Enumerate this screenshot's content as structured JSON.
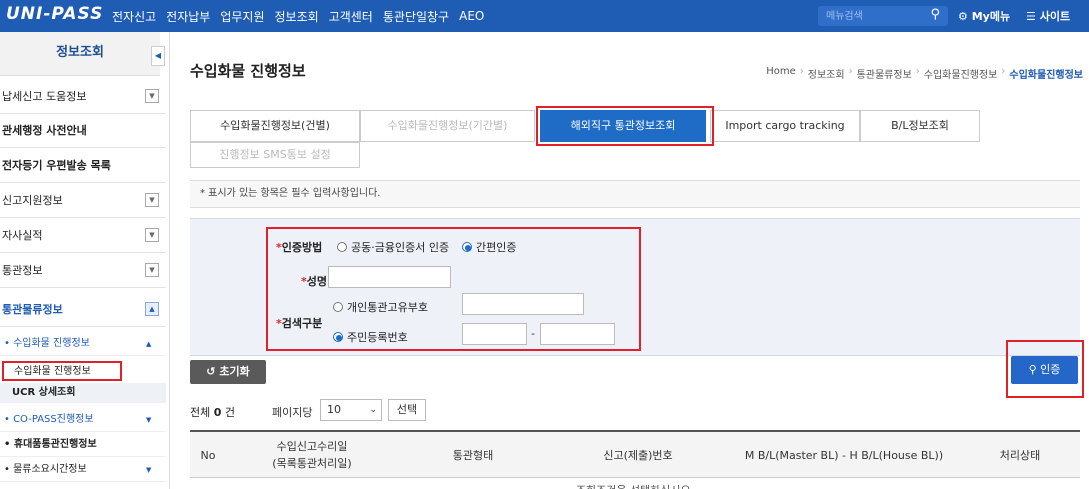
{
  "topbar": {
    "logo": "UNI-PASS",
    "nav": [
      "전자신고",
      "전자납부",
      "업무지원",
      "정보조회",
      "고객센터",
      "통관단일창구",
      "AEO"
    ],
    "search_placeholder": "메뉴검색",
    "mymenu": "My메뉴",
    "site": "사이트",
    "colors": {
      "bar": "#1f5cb4"
    }
  },
  "sidebar": {
    "title": "정보조회",
    "items": [
      {
        "label": "납세신고 도움정보",
        "chevron": "down",
        "bold": false
      },
      {
        "label": "관세행정 사전안내",
        "chevron": "",
        "bold": true
      },
      {
        "label": "전자등기 우편발송 목록",
        "chevron": "",
        "bold": true
      },
      {
        "label": "신고지원정보",
        "chevron": "down",
        "bold": false
      },
      {
        "label": "자사실적",
        "chevron": "down",
        "bold": false
      },
      {
        "label": "통관정보",
        "chevron": "down",
        "bold": false
      },
      {
        "label": "통관물류정보",
        "chevron": "up",
        "bold": false,
        "active": true
      }
    ],
    "sub": {
      "cargo": "수입화물 진행정보",
      "cargo_leaf": "수입화물 진행정보",
      "ucr": "UCR 상세조회",
      "copass": "CO-PASS진행정보",
      "handcarry": "휴대품통관진행정보",
      "logistics": "물류소요시간정보"
    }
  },
  "main": {
    "title": "수입화물 진행정보",
    "breadcrumb": [
      "Home",
      "정보조회",
      "통관물류정보",
      "수입화물진행정보",
      "수입화물진행정보"
    ],
    "tabs": [
      "수입화물진행정보(건별)",
      "수입화물진행정보(기간별)",
      "해외직구 통관정보조회",
      "Import cargo tracking",
      "B/L정보조회",
      "진행정보 SMS통보 설정"
    ],
    "notice": "* 표시가 있는 항목은 필수 입력사항입니다.",
    "form": {
      "auth_label": "인증방법",
      "auth_opt1": "공동·금융인증서 인증",
      "auth_opt2": "간편인증",
      "name_label": "성명",
      "search_label": "검색구분",
      "search_opt1": "개인통관고유부호",
      "search_opt2": "주민등록번호",
      "required_mark": "*",
      "dash": "-"
    },
    "reset_label": "초기화",
    "auth_button": "인증",
    "total_prefix": "전체",
    "total_count": "0",
    "total_suffix": "건",
    "perpage_label": "페이지당",
    "perpage_value": "10",
    "select_button": "선택",
    "grid": {
      "headers": [
        "No",
        "수입신고수리일\n(목록통관처리일)",
        "통관형태",
        "신고(제출)번호",
        "M B/L(Master BL) - H B/L(House BL))",
        "처리상태"
      ],
      "empty": "조회조건을 선택하십시오."
    }
  }
}
